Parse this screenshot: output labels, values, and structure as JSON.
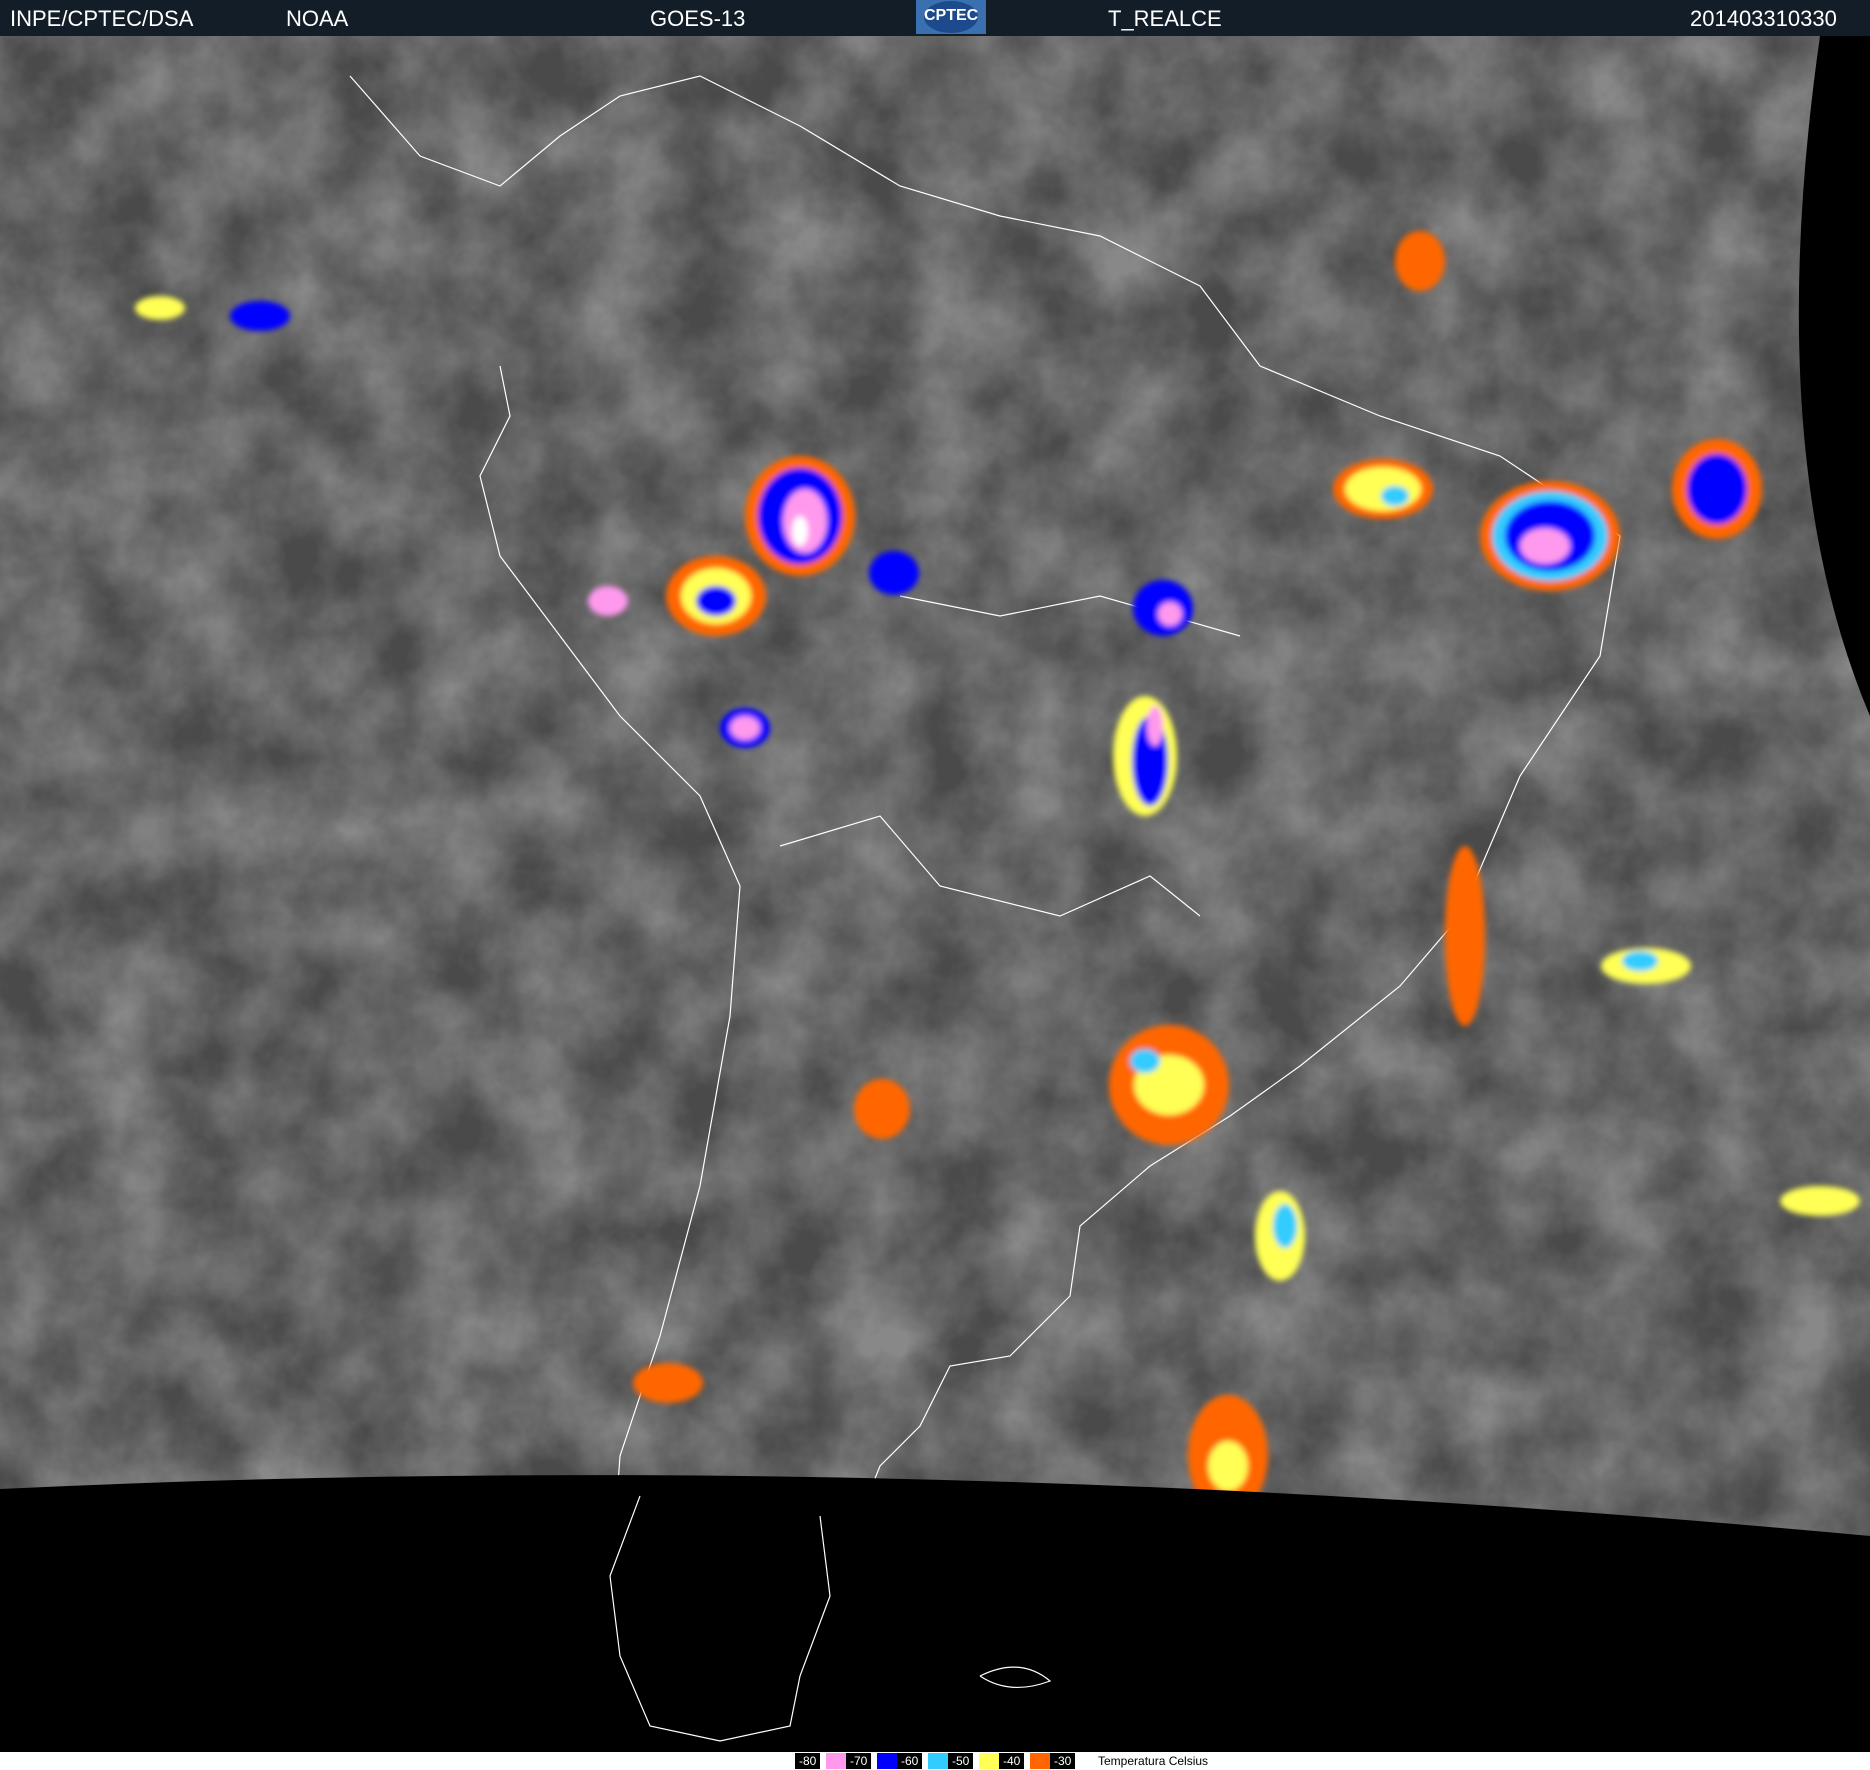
{
  "header": {
    "institution": "INPE/CPTEC/DSA",
    "agency": "NOAA",
    "satellite": "GOES-13",
    "logo_text": "CPTEC",
    "product": "T_REALCE",
    "timestamp": "201403310330"
  },
  "legend": {
    "items": [
      {
        "label": "-80",
        "color": "#ff99ee"
      },
      {
        "label": "-70",
        "color": "#0000ff"
      },
      {
        "label": "-60",
        "color": "#33ccff"
      },
      {
        "label": "-50",
        "color": "#ffff55"
      },
      {
        "label": "-40",
        "color": "#ff6600"
      },
      {
        "label": "-30",
        "color": null
      }
    ],
    "title": "Temperatura   Celsius"
  }
}
